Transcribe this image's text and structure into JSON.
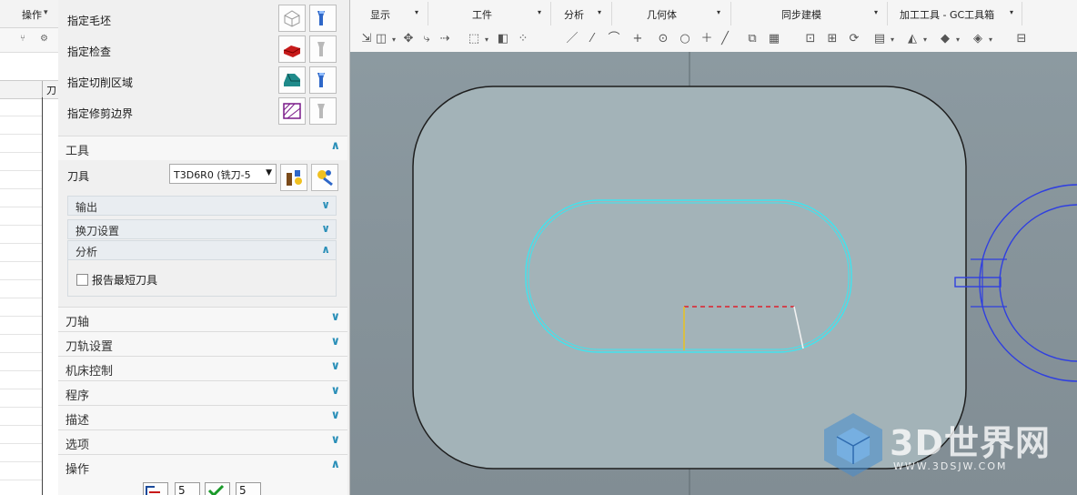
{
  "menubar": {
    "left_tab": "操作",
    "items": [
      "显示",
      "工件",
      "分析",
      "几何体",
      "同步建模",
      "加工工具 - GC工具箱"
    ]
  },
  "left_strip": {
    "col_header": "刀"
  },
  "panel": {
    "geometry_rows": [
      {
        "label": "指定毛坯",
        "icon": "blank-cube-icon"
      },
      {
        "label": "指定检查",
        "icon": "check-body-icon"
      },
      {
        "label": "指定切削区域",
        "icon": "cut-area-icon"
      },
      {
        "label": "指定修剪边界",
        "icon": "trim-boundary-icon"
      }
    ],
    "tool_section": {
      "title": "工具",
      "tool_label": "刀具",
      "tool_value": "T3D6R0 (铣刀-5",
      "subsections": [
        "输出",
        "换刀设置"
      ],
      "analysis_title": "分析",
      "checkbox_label": "报告最短刀具",
      "checkbox_checked": false
    },
    "collapsed_sections": [
      "刀轴",
      "刀轨设置",
      "机床控制",
      "程序",
      "描述",
      "选项"
    ],
    "operations_title": "操作",
    "operation_buttons": [
      "5",
      "5"
    ]
  },
  "watermark": {
    "brand": "3D世界网",
    "url": "WWW.3DSJW.COM"
  },
  "colors": {
    "viewport_bg": "#86939a",
    "part_fill": "#a3b3b8",
    "toolpath": "#3fe4ef",
    "fixture": "#2f3fe0",
    "accent": "#2a8fb8"
  }
}
